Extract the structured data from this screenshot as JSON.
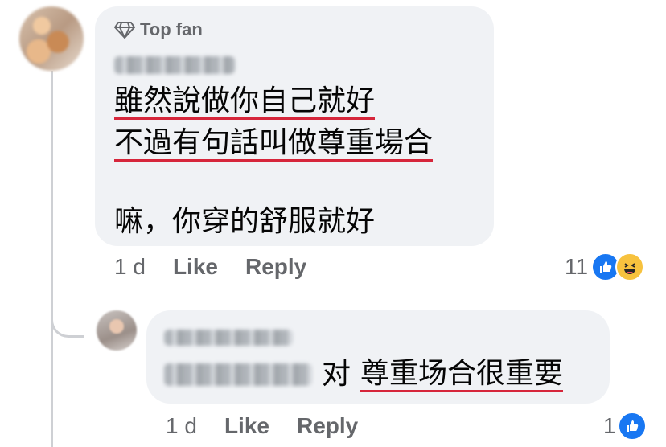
{
  "comment1": {
    "badge": "Top fan",
    "lines": [
      "雖然說做你自己就好",
      "不過有句話叫做尊重場合",
      "嘛，你穿的舒服就好"
    ],
    "time": "1 d",
    "like_label": "Like",
    "reply_label": "Reply",
    "reaction_count": "11"
  },
  "comment2": {
    "text_suffix": "对",
    "highlight": "尊重场合很重要",
    "time": "1 d",
    "like_label": "Like",
    "reply_label": "Reply",
    "reaction_count": "1"
  },
  "colors": {
    "underline": "#d6263b",
    "bubble": "#f0f2f5",
    "like_blue": "#1877f2",
    "meta_gray": "#65676b"
  },
  "icons": [
    "diamond-icon",
    "like-reaction-icon",
    "haha-reaction-icon"
  ]
}
